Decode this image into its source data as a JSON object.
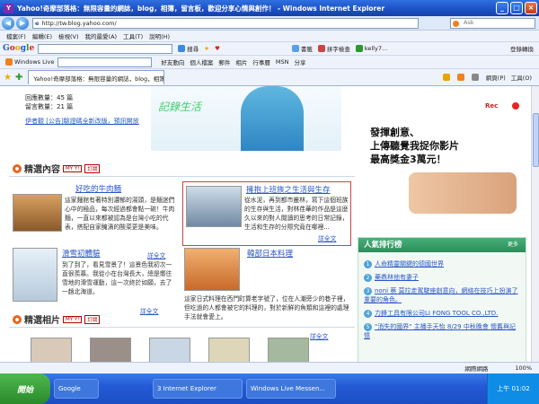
{
  "window": {
    "title": "Yahoo!奇摩部落格：無限容量的網誌，blog，相簿，留言板，歡迎分享心情與創作！ - Windows Internet Explorer"
  },
  "address": {
    "url": "http://tw.blog.yahoo.com/",
    "search_placeholder": "Ask"
  },
  "menu": [
    "檔案(F)",
    "編輯(E)",
    "檢視(V)",
    "我的最愛(A)",
    "工具(T)",
    "說明(H)"
  ],
  "google_bar": {
    "logo": "Google",
    "items": [
      "搜尋",
      "★",
      "♥",
      "書籤",
      "拼字檢查",
      "kelly7...",
      "登錄轉換"
    ]
  },
  "live_bar": {
    "logo": "Windows Live",
    "items": [
      "好友動向",
      "個人檔案",
      "郵件",
      "相片",
      "行事曆",
      "MSN",
      "分享"
    ]
  },
  "tab": {
    "label": "Yahoo!奇摩部落格：無限容量的網誌，blog，相簿...",
    "page": "網頁(P)",
    "tools": "工具(O)"
  },
  "top": {
    "stats": [
      {
        "label": "回應數量：45 篇"
      },
      {
        "label": "留言數量：21 篇"
      }
    ],
    "note": "伊者觀 [公告]驗證碼全新改版，預訊開放",
    "doodle": "記錄生活"
  },
  "featured": {
    "heading": "精選內容",
    "badge1": "MY Y!",
    "badge2": "訂閱",
    "cards": [
      {
        "title": "好吃的牛肉麵",
        "body": "這家麵館有著特別濃郁的湯頭，是麵迷們心中的極品，每次經過都會點一碗！牛肉麵，一直以來都被認為是台灣小吃的代表，搭配自家醃漬的酸菜更是美味。",
        "more": "詳全文"
      },
      {
        "title": "擁抱上班族之生活與生存",
        "body": "從水泥，再到都市叢林，寫下這個班族的生存與生活，對林荏華的作品是這麼久以來的對人閱讀的思考的日常記錄，生活和生存的分際究竟在哪裡...",
        "more": "詳全文"
      },
      {
        "title": "滑雪初體驗",
        "body": "到了到了，看見雪景了！這景色我初次一直很羨慕。我從小在台灣長大，總是嚮往雪地的滑雪運動，這一次終於如願，去了一趟北海道。",
        "more": "詳全文"
      },
      {
        "title": "韓部日本料理",
        "body": "這家日式料理在西門町算老字號了，位在人潮旁少的巷子裡，但吃過的人都會被它的料理的，對於新鮮的魚類和這裡的處理手法就會愛上。",
        "more": "詳全文"
      }
    ]
  },
  "photos": {
    "heading": "精選相片",
    "badge1": "MY Y!",
    "badge2": "訂閱"
  },
  "ad": {
    "line1": "發揮創意、",
    "line2": "上傳聽覺我捉你影片",
    "line3": "最高獎金3萬元！",
    "rec": "Rec"
  },
  "rank": {
    "heading": "人氣排行榜",
    "more": "更多",
    "items": [
      "人命精靈關鍵的德國世界",
      "藥鼎林他有妻子",
      "noni 蔡 莫拉走駕駛座創意向，網絡在技巧上扮演了重要的角色。",
      "力鋒工具有限公司LI FONG TOOL CO.,LTD.",
      "\"消失的國界\" 主播手天怡 8/29 中秋晚會 懷舊與記憶"
    ]
  },
  "status": {
    "text": "網際網路",
    "zoom": "100%"
  },
  "taskbar": {
    "start": "開始",
    "tasks": [
      "Google",
      "3 Internet Explorer",
      "Windows Live Messen..."
    ],
    "time": "上午 01:02"
  }
}
